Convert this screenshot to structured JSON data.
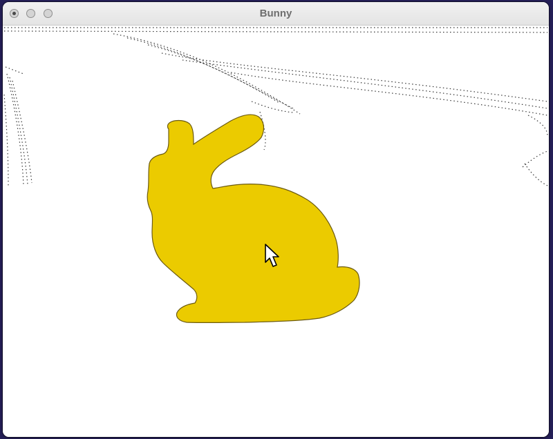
{
  "window": {
    "title": "Bunny"
  },
  "traffic_lights": [
    "close",
    "minimize",
    "zoom"
  ],
  "scene": {
    "background_color": "#ffffff",
    "model_color": "#ebcb00",
    "outline_color": "#6b5a10",
    "artifact_color": "#111111"
  },
  "icons": {
    "pointer": "mouse-pointer-icon"
  }
}
